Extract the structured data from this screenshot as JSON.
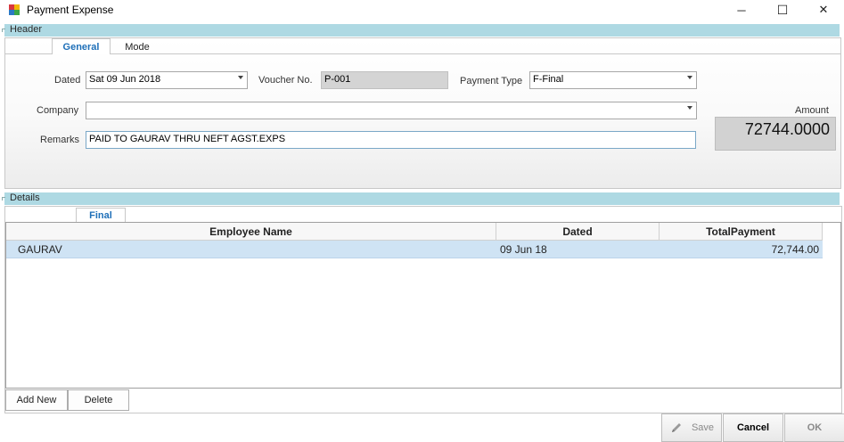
{
  "window": {
    "title": "Payment Expense",
    "minimize_glyph": "─",
    "maximize_glyph": "☐",
    "close_glyph": "✕"
  },
  "header_section": {
    "label": "Header",
    "tabs": [
      {
        "label": "General",
        "active": true
      },
      {
        "label": "Mode",
        "active": false
      }
    ],
    "dated_label": "Dated",
    "dated_value": "Sat 09 Jun 2018",
    "voucher_label": "Voucher No.",
    "voucher_value": "P-001",
    "payment_type_label": "Payment Type",
    "payment_type_value": "F-Final",
    "company_label": "Company",
    "company_value": "",
    "remarks_label": "Remarks",
    "remarks_value": "PAID TO  GAURAV  THRU NEFT AGST.EXPS",
    "amount_label": "Amount",
    "amount_value": "72744.0000"
  },
  "details_section": {
    "label": "Details",
    "tab_label": "Final",
    "columns": [
      "Employee Name",
      "Dated",
      "TotalPayment"
    ],
    "rows": [
      {
        "employee": "GAURAV",
        "dated": "09 Jun 18",
        "total": "72,744.00"
      }
    ],
    "add_new_label": "Add New",
    "delete_label": "Delete"
  },
  "footer": {
    "save_label": "Save",
    "cancel_label": "Cancel",
    "ok_label": "OK"
  },
  "colors": {
    "section_bar": "#aed9e3",
    "active_tab_text": "#1e6fb8",
    "selected_row": "#cfe3f4"
  }
}
